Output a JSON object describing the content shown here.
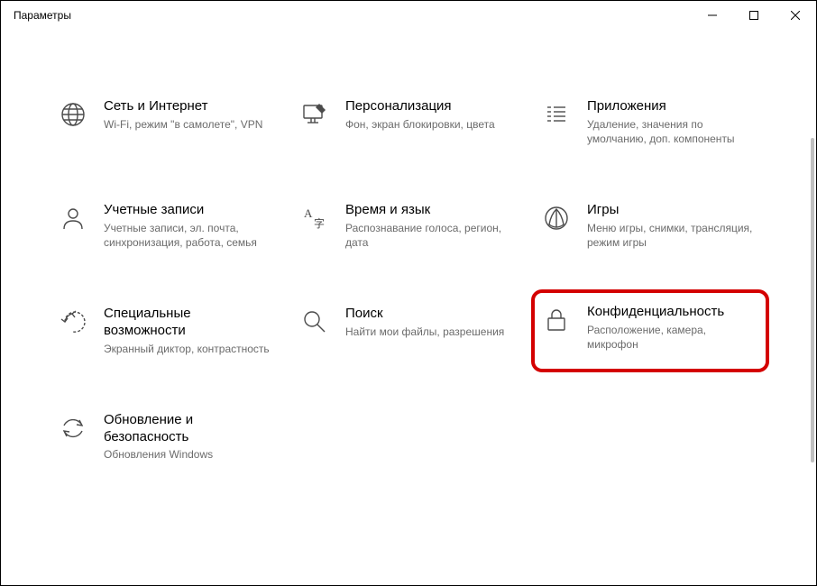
{
  "window": {
    "title": "Параметры"
  },
  "tiles": [
    {
      "title": "Сеть и Интернет",
      "desc": "Wi-Fi, режим \"в самолете\", VPN",
      "icon": "globe-icon"
    },
    {
      "title": "Персонализация",
      "desc": "Фон, экран блокировки, цвета",
      "icon": "personalization-icon"
    },
    {
      "title": "Приложения",
      "desc": "Удаление, значения по умолчанию, доп. компоненты",
      "icon": "apps-icon"
    },
    {
      "title": "Учетные записи",
      "desc": "Учетные записи, эл. почта, синхронизация, работа, семья",
      "icon": "accounts-icon"
    },
    {
      "title": "Время и язык",
      "desc": "Распознавание голоса, регион, дата",
      "icon": "time-language-icon"
    },
    {
      "title": "Игры",
      "desc": "Меню игры, снимки, трансляция, режим игры",
      "icon": "gaming-icon"
    },
    {
      "title": "Специальные возможности",
      "desc": "Экранный диктор, контрастность",
      "icon": "accessibility-icon"
    },
    {
      "title": "Поиск",
      "desc": "Найти мои файлы, разрешения",
      "icon": "search-icon"
    },
    {
      "title": "Конфиденциальность",
      "desc": "Расположение, камера, микрофон",
      "icon": "privacy-icon",
      "highlighted": true
    },
    {
      "title": "Обновление и безопасность",
      "desc": "Обновления Windows",
      "icon": "update-icon"
    }
  ]
}
